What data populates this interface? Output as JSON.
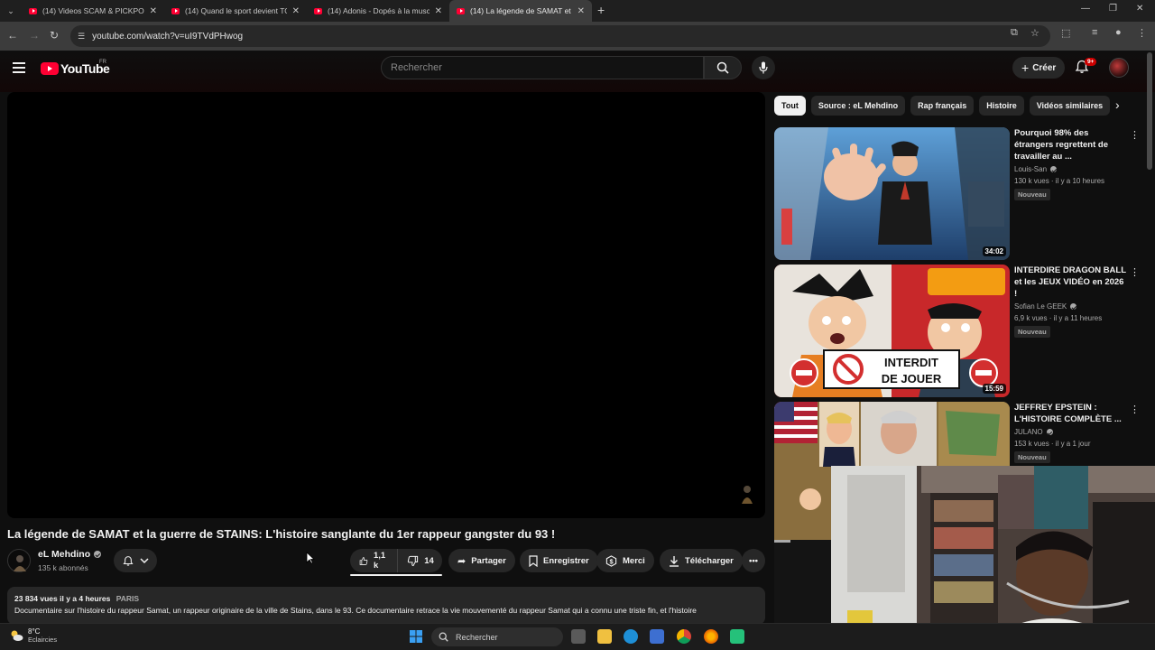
{
  "browser": {
    "tabs": [
      {
        "title": "(14) Videos SCAM & PICKPOCK",
        "active": false
      },
      {
        "title": "(14) Quand le sport devient TOX",
        "active": false
      },
      {
        "title": "(14) Adonis - Dopés à la muscu",
        "active": false
      },
      {
        "title": "(14) La légende de SAMAT et la",
        "active": true
      }
    ],
    "url": "youtube.com/watch?v=uI9TVdPHwog"
  },
  "header": {
    "logo_text": "YouTube",
    "country": "FR",
    "search_placeholder": "Rechercher",
    "create_label": "Créer",
    "notifications": "9+"
  },
  "video": {
    "title": "La légende de SAMAT et la guerre de STAINS: L'histoire sanglante du 1er rappeur gangster du 93 !",
    "channel": "eL Mehdino",
    "subscribers": "135 k abonnés",
    "likes": "1,1 k",
    "dislikes": "14",
    "actions": {
      "share": "Partager",
      "save": "Enregistrer",
      "thanks": "Merci",
      "download": "Télécharger"
    },
    "views": "23 834 vues",
    "date": "il y a 4 heures",
    "location": "PARIS",
    "description": "Documentaire sur l'histoire du rappeur Samat, un rappeur originaire de la ville de Stains, dans le 93. Ce documentaire retrace la vie mouvementé du rappeur Samat qui a connu une triste fin, et l'histoire"
  },
  "chips": [
    "Tout",
    "Source : eL Mehdino",
    "Rap français",
    "Histoire",
    "Vidéos similaires"
  ],
  "recommendations": [
    {
      "title": "Pourquoi 98% des étrangers regrettent de travailler au ...",
      "channel": "Louis-San",
      "stats": "130 k vues · il y a 10 heures",
      "badge": "Nouveau",
      "duration": "34:02"
    },
    {
      "title": "INTERDIRE DRAGON BALL et les JEUX VIDÉO en 2026 !",
      "channel": "Sofian Le GEEK",
      "stats": "6,9 k vues · il y a 11 heures",
      "badge": "Nouveau",
      "duration": "15:59",
      "thumb_text": [
        "INTERDIT",
        "DE JOUER"
      ]
    },
    {
      "title": "JEFFREY EPSTEIN : L'HISTOIRE COMPLÈTE ...",
      "channel": "JULANO",
      "stats": "153 k vues · il y a 1 jour",
      "badge": "Nouveau",
      "duration": ""
    }
  ],
  "taskbar": {
    "temperature": "8°C",
    "weather": "Eclaircies",
    "search_label": "Rechercher"
  },
  "colors": {
    "background": "#0f0f0f",
    "brand_red": "#ff0033",
    "pill": "#272727",
    "text_secondary": "#aaaaaa"
  }
}
